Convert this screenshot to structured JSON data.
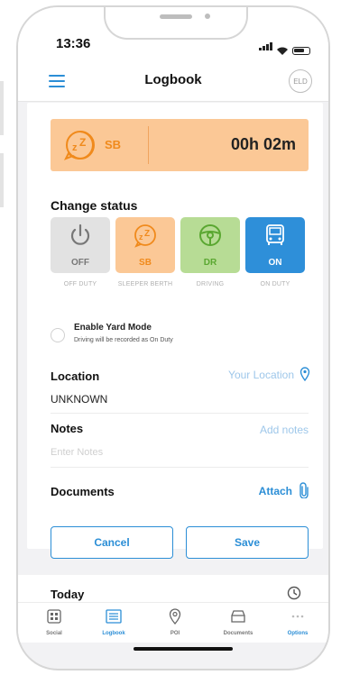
{
  "status_bar": {
    "time": "13:36"
  },
  "header": {
    "title": "Logbook",
    "eld_badge": "ELD"
  },
  "current_status": {
    "code": "SB",
    "duration": "00h 02m"
  },
  "change_status": {
    "title": "Change status",
    "options": [
      {
        "code": "OFF",
        "caption": "OFF DUTY"
      },
      {
        "code": "SB",
        "caption": "SLEEPER BERTH"
      },
      {
        "code": "DR",
        "caption": "DRIVING"
      },
      {
        "code": "ON",
        "caption": "ON DUTY"
      }
    ]
  },
  "yard_mode": {
    "title": "Enable Yard Mode",
    "description": "Driving will be recorded as On Duty"
  },
  "location": {
    "label": "Location",
    "action": "Your Location",
    "value": "UNKNOWN"
  },
  "notes": {
    "label": "Notes",
    "action": "Add notes",
    "placeholder": "Enter Notes"
  },
  "documents": {
    "label": "Documents",
    "action": "Attach"
  },
  "actions": {
    "cancel": "Cancel",
    "save": "Save"
  },
  "today": {
    "label": "Today"
  },
  "tabs": [
    {
      "label": "Social",
      "icon": "social-icon"
    },
    {
      "label": "Logbook",
      "icon": "logbook-icon"
    },
    {
      "label": "POI",
      "icon": "poi-icon"
    },
    {
      "label": "Documents",
      "icon": "documents-icon"
    },
    {
      "label": "Options",
      "icon": "options-icon"
    }
  ],
  "colors": {
    "accent": "#2b8ed6",
    "sleeper": "#fbc896",
    "driving": "#b7dc95",
    "on_duty": "#2e8fd9",
    "off_duty": "#e2e2e2"
  }
}
